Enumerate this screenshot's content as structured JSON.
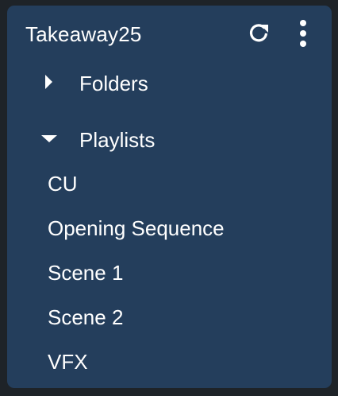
{
  "panel": {
    "title": "Takeaway25",
    "icons": {
      "refresh": "refresh-icon",
      "more": "more-vertical-icon"
    }
  },
  "sections": {
    "folders": {
      "label": "Folders",
      "expanded": false
    },
    "playlists": {
      "label": "Playlists",
      "expanded": true
    }
  },
  "playlists": [
    "CU",
    "Opening Sequence",
    "Scene 1",
    "Scene 2",
    "VFX"
  ],
  "colors": {
    "background": "#1e2328",
    "panel": "#243e5c",
    "text": "#ffffff"
  }
}
